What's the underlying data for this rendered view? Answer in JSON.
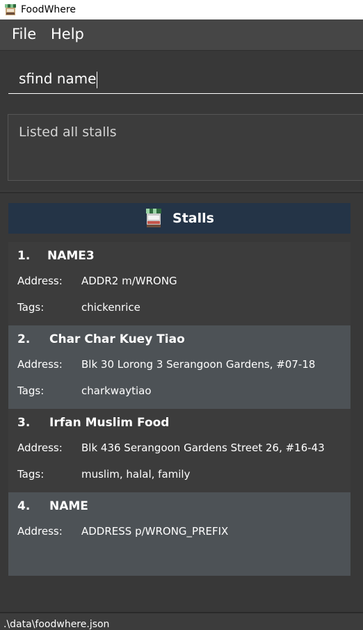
{
  "window": {
    "title": "FoodWhere",
    "icon": "stall-icon"
  },
  "menu": {
    "file": "File",
    "help": "Help"
  },
  "command": {
    "value": "sfind name"
  },
  "result": {
    "text": "Listed all stalls"
  },
  "list": {
    "header": "Stalls",
    "address_label": "Address:",
    "tags_label": "Tags:",
    "stalls": [
      {
        "index": "1.",
        "name": "NAME3",
        "address": "ADDR2 m/WRONG",
        "tags": "chickenrice"
      },
      {
        "index": "2.",
        "name": "Char Char Kuey Tiao",
        "address": "Blk 30 Lorong 3 Serangoon Gardens, #07-18",
        "tags": "charkwaytiao"
      },
      {
        "index": "3.",
        "name": "Irfan Muslim Food",
        "address": "Blk 436 Serangoon Gardens Street 26, #16-43",
        "tags": "muslim, halal, family"
      },
      {
        "index": "4.",
        "name": "NAME",
        "address": "ADDRESS p/WRONG_PREFIX",
        "tags": ""
      }
    ]
  },
  "status": {
    "path": ".\\data\\foodwhere.json"
  },
  "colors": {
    "header_bg": "#243447",
    "card_alt_bg": "#4d5256",
    "background": "#383838"
  }
}
